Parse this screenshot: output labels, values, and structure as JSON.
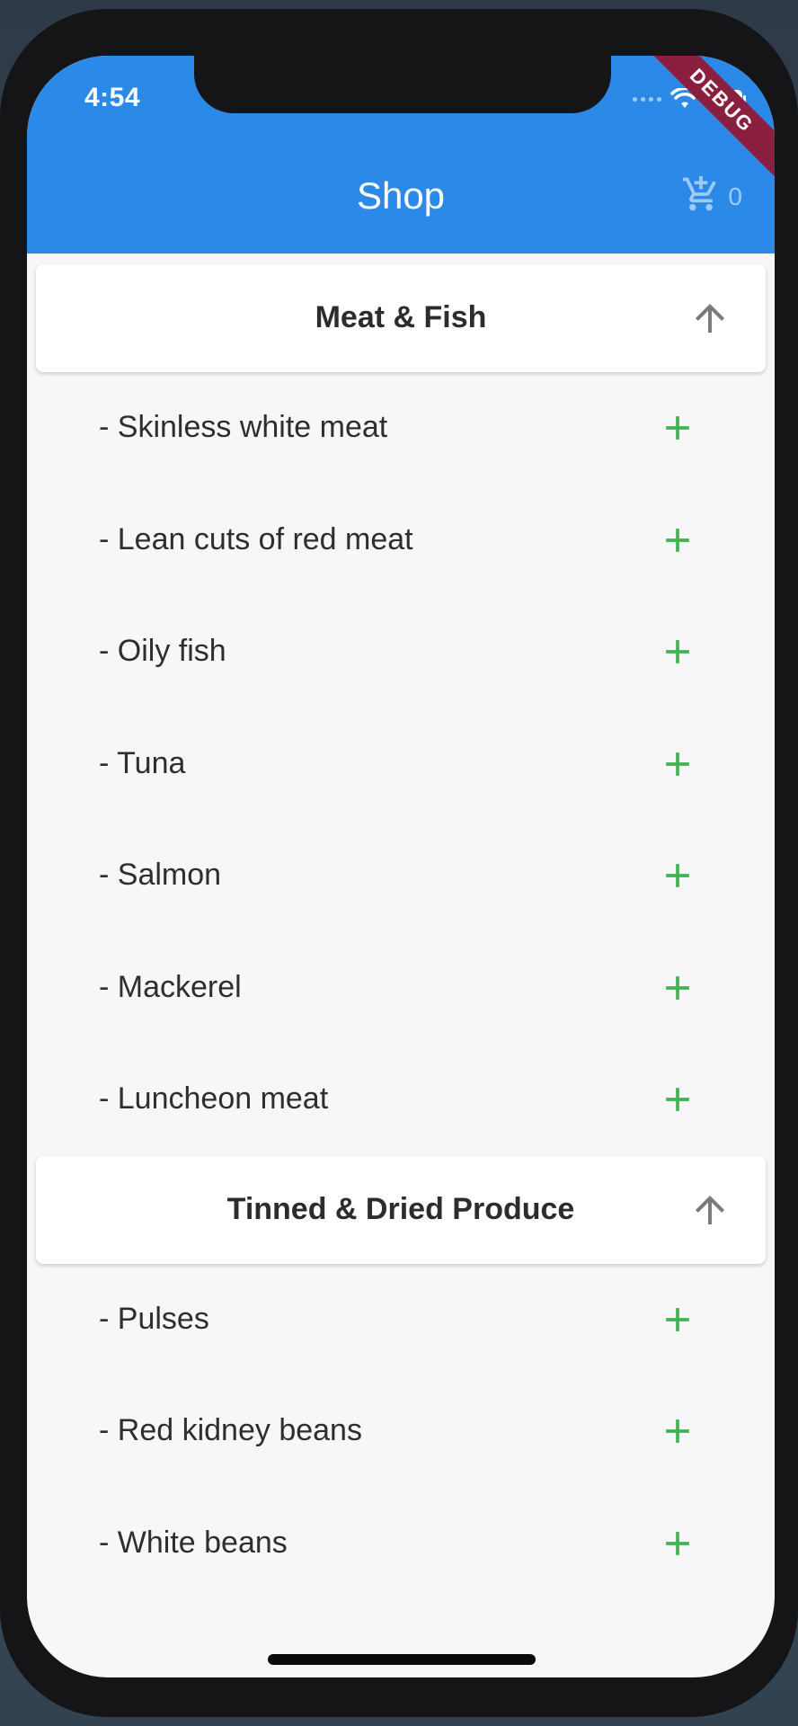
{
  "status_bar": {
    "time": "4:54",
    "debug_label": "DEBUG"
  },
  "app_bar": {
    "title": "Shop",
    "cart_count": "0",
    "cart_icon": "add-shopping-cart-icon"
  },
  "sections": [
    {
      "title": "Meat & Fish",
      "toggle_icon": "arrow-up-icon",
      "items": [
        "- Skinless white meat",
        "- Lean cuts of red meat",
        "- Oily fish",
        "- Tuna",
        "- Salmon",
        "- Mackerel",
        "- Luncheon meat"
      ]
    },
    {
      "title": "Tinned & Dried Produce",
      "toggle_icon": "arrow-up-icon",
      "items": [
        "- Pulses",
        "- Red kidney beans",
        "- White beans"
      ]
    }
  ],
  "colors": {
    "app_bar": "#2b8ae8",
    "add_icon": "#3fb34f",
    "toggle_icon": "#7a7a7a",
    "debug_banner": "#8a1f3f"
  }
}
